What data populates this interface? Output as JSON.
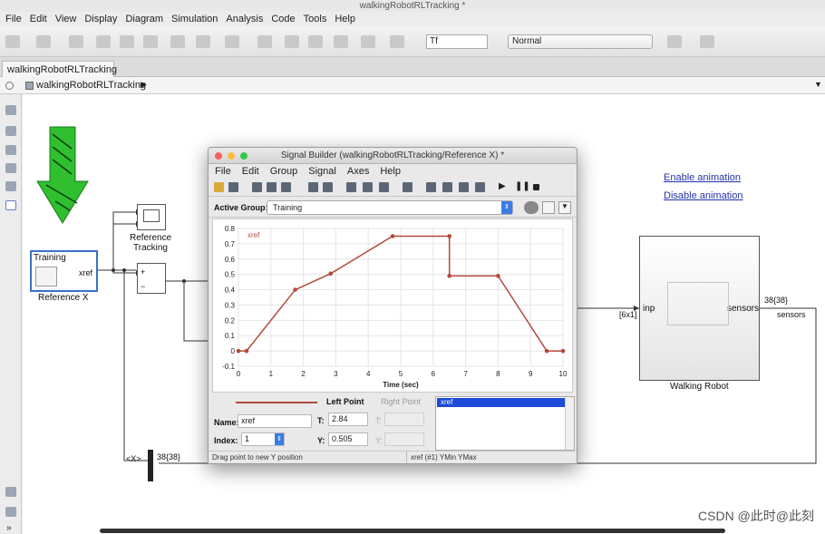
{
  "window": {
    "title": "walkingRobotRLTracking *"
  },
  "menu": [
    "File",
    "Edit",
    "View",
    "Display",
    "Diagram",
    "Simulation",
    "Analysis",
    "Code",
    "Tools",
    "Help"
  ],
  "toolbar": {
    "stop_time": "Tf",
    "sim_mode": "Normal"
  },
  "tab": {
    "label": "walkingRobotRLTracking"
  },
  "breadcrumb": {
    "model": "walkingRobotRLTracking"
  },
  "diagram": {
    "signal_builder_block": {
      "group": "Training",
      "port": "xref",
      "name": "Reference X"
    },
    "scope_block": {
      "name_line1": "Reference",
      "name_line2": "Tracking"
    },
    "sum_block": {
      "plus": "+",
      "minus": "−"
    },
    "links": {
      "enable": "Enable animation",
      "disable": "Disable animation"
    },
    "robot_block": {
      "in_port": "inp",
      "out_port": "sensors",
      "name": "Walking Robot",
      "in_dim": "[6x1]",
      "out_dim": "38{38}",
      "out_signal": "sensors"
    },
    "bus_label_left": "<X>",
    "bus_dim": "38{38}"
  },
  "signal_builder": {
    "title": "Signal Builder (walkingRobotRLTracking/Reference X) *",
    "menu": [
      "File",
      "Edit",
      "Group",
      "Signal",
      "Axes",
      "Help"
    ],
    "active_group_label": "Active Group:",
    "active_group_value": "Training",
    "legend": "xref",
    "x_axis_label": "Time (sec)",
    "left_point_label": "Left Point",
    "right_point_label": "Right Point",
    "name_label": "Name:",
    "name_value": "xref",
    "index_label": "Index:",
    "index_value": "1",
    "t_label": "T:",
    "t_value": "2.84",
    "y_label": "Y:",
    "y_value": "0.505",
    "t2_label": "T:",
    "y2_label": "Y:",
    "signal_list_item": "xref",
    "status_left": "Drag point to new Y position",
    "status_right": "xref (#1)  YMin YMax"
  },
  "chart_data": {
    "type": "line",
    "series": [
      {
        "name": "xref",
        "x": [
          0,
          0.25,
          1.75,
          2.84,
          4.75,
          6.5,
          6.5,
          8.0,
          9.5,
          10.0
        ],
        "y": [
          0,
          0,
          0.4,
          0.505,
          0.75,
          0.75,
          0.49,
          0.49,
          0,
          0
        ]
      }
    ],
    "xlim": [
      0,
      10
    ],
    "ylim": [
      -0.1,
      0.8
    ],
    "xticks": [
      "0",
      "1",
      "2",
      "3",
      "4",
      "5",
      "6",
      "7",
      "8",
      "9",
      "10"
    ],
    "yticks": [
      "-0.1",
      "0",
      "0.1",
      "0.2",
      "0.3",
      "0.4",
      "0.5",
      "0.6",
      "0.7",
      "0.8"
    ],
    "xlabel": "Time (sec)",
    "ylabel": "",
    "grid": true,
    "color": "#b24b3c"
  },
  "watermark": "CSDN @此时@此刻",
  "colors": {
    "accent_green": "#2fbf2f",
    "link_blue": "#2233aa",
    "select_blue": "#1f49d8",
    "line_red": "#b24b3c"
  }
}
